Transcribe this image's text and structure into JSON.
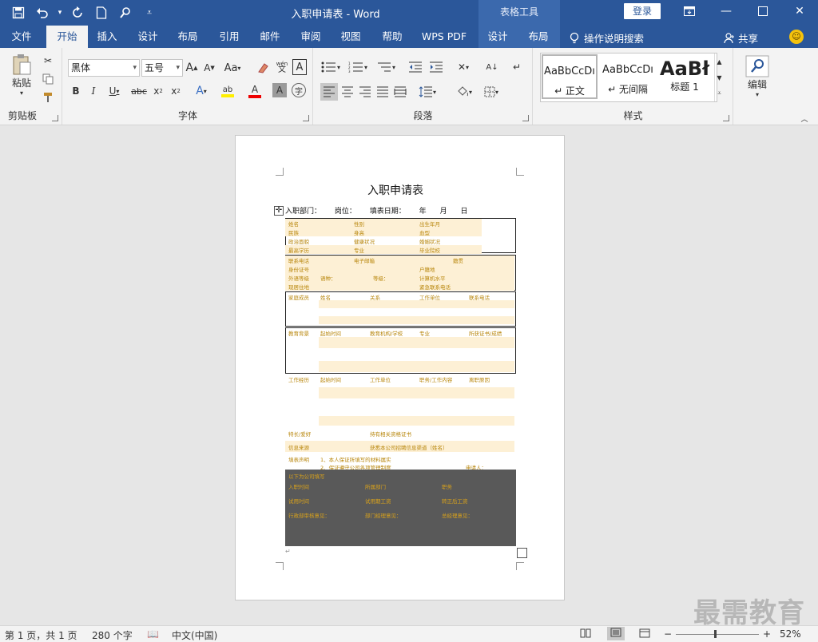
{
  "window": {
    "doc_title": "入职申请表 - Word",
    "context_tool": "表格工具",
    "login": "登录"
  },
  "tabs": [
    {
      "label": "文件"
    },
    {
      "label": "开始"
    },
    {
      "label": "插入"
    },
    {
      "label": "设计"
    },
    {
      "label": "布局"
    },
    {
      "label": "引用"
    },
    {
      "label": "邮件"
    },
    {
      "label": "审阅"
    },
    {
      "label": "视图"
    },
    {
      "label": "帮助"
    },
    {
      "label": "WPS PDF"
    },
    {
      "label": "设计"
    },
    {
      "label": "布局"
    }
  ],
  "tellme": "操作说明搜索",
  "share": "共享",
  "ribbon": {
    "clipboard": {
      "paste": "粘贴",
      "label": "剪贴板"
    },
    "font": {
      "family": "黑体",
      "size": "五号",
      "label": "字体",
      "change_case": "Aa",
      "phonetic": "wén"
    },
    "paragraph": {
      "label": "段落"
    },
    "styles": {
      "label": "样式",
      "items": [
        {
          "sample": "AaBbCcDı",
          "name": "↵ 正文"
        },
        {
          "sample": "AaBbCcDı",
          "name": "↵ 无间隔"
        },
        {
          "sample": "AaBł",
          "name": "标题 1"
        }
      ]
    },
    "editing": {
      "label": "编辑"
    }
  },
  "document": {
    "heading": "入职申请表",
    "info_line": [
      "入职部门：",
      "岗位：",
      "填表日期：",
      "年",
      "月",
      "日"
    ],
    "bands": [
      {
        "cells": [
          "姓名",
          "性别",
          "出生年月"
        ]
      },
      {
        "cells": [
          "民族",
          "身高",
          "血型"
        ]
      },
      {
        "cells": [
          "政治面貌",
          "健康状况",
          "婚姻状况"
        ]
      },
      {
        "cells": [
          "最高学历",
          "专业",
          "毕业院校"
        ]
      },
      {
        "cells": [
          "联系电话",
          "电子邮箱",
          "籍贯"
        ]
      },
      {
        "cells": [
          "身份证号",
          "户籍地"
        ]
      },
      {
        "cells": [
          "外语等级",
          "语种：",
          "等级：",
          "计算机水平"
        ]
      },
      {
        "cells": [
          "现居住地",
          "紧急联系电话"
        ]
      },
      {
        "cells": [
          "家庭成员",
          "姓名",
          "关系",
          "工作单位",
          "联系电话"
        ]
      },
      {
        "cells": [
          "教育背景",
          "起始时间",
          "教育机构/学校",
          "专业",
          "所获证书/成绩"
        ]
      },
      {
        "cells": [
          "工作经历",
          "起始时间",
          "工作单位",
          "职务/工作内容",
          "离职原因"
        ]
      },
      {
        "cells": [
          "特长/爱好",
          "持有相关资格证书"
        ]
      },
      {
        "cells": [
          "信息来源",
          "获悉本公司招聘信息渠道（姓名）"
        ]
      },
      {
        "cells": [
          "填表声明",
          "1、本人保证所填写的材料属实",
          "2、保证遵守公司各项管理制度",
          "申请人："
        ]
      }
    ],
    "office": {
      "title": "以下为公司填写",
      "rows": [
        [
          "入职时间",
          "所属部门",
          "职务"
        ],
        [
          "试用时间",
          "试用期工资",
          "转正后工资"
        ],
        [
          "行政部审核意见：",
          "部门经理意见：",
          "总经理意见："
        ]
      ]
    }
  },
  "status": {
    "page": "第 1 页，共 1 页",
    "words": "280 个字",
    "lang": "中文(中国)",
    "zoom": "52%"
  },
  "watermark": "最需教育"
}
